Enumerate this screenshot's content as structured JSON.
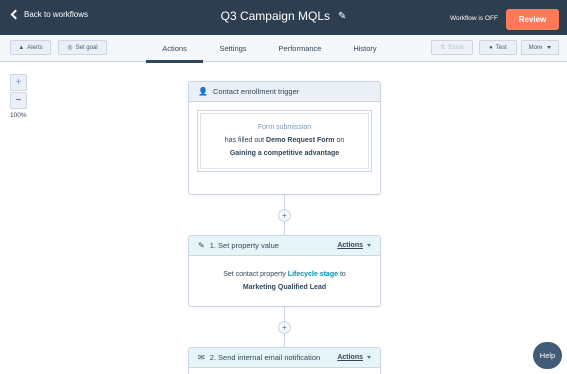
{
  "header": {
    "back_label": "Back to workflows",
    "title": "Q3 Campaign MQLs",
    "edit_icon": "pencil-icon",
    "status": "Workflow is OFF",
    "review_label": "Review",
    "accent_color": "#ff7a59",
    "bar_color": "#2d3e50"
  },
  "subbar": {
    "alerts_label": "Alerts",
    "set_goal_label": "Set goal",
    "tabs": [
      {
        "label": "Actions",
        "active": true
      },
      {
        "label": "Settings",
        "active": false
      },
      {
        "label": "Performance",
        "active": false
      },
      {
        "label": "History",
        "active": false
      }
    ],
    "enroll_label": "Enroll",
    "test_label": "Test",
    "more_label": "More"
  },
  "zoom": {
    "plus": "+",
    "minus": "−",
    "level": "100%"
  },
  "trigger": {
    "title": "Contact enrollment trigger",
    "filter_type": "Form submission",
    "text_before": "has filled out",
    "form_name": "Demo Request Form",
    "text_on": "on",
    "page_name": "Gaining a competitive advantage"
  },
  "actions": [
    {
      "title": "1. Set property value",
      "actions_label": "Actions",
      "text_before": "Set contact property",
      "property": "Lifecycle stage",
      "text_to": "to",
      "value": "Marketing Qualified Lead"
    },
    {
      "title": "2. Send internal email notification",
      "actions_label": "Actions"
    }
  ],
  "connectors": {
    "plus": "+"
  },
  "help_label": "Help"
}
